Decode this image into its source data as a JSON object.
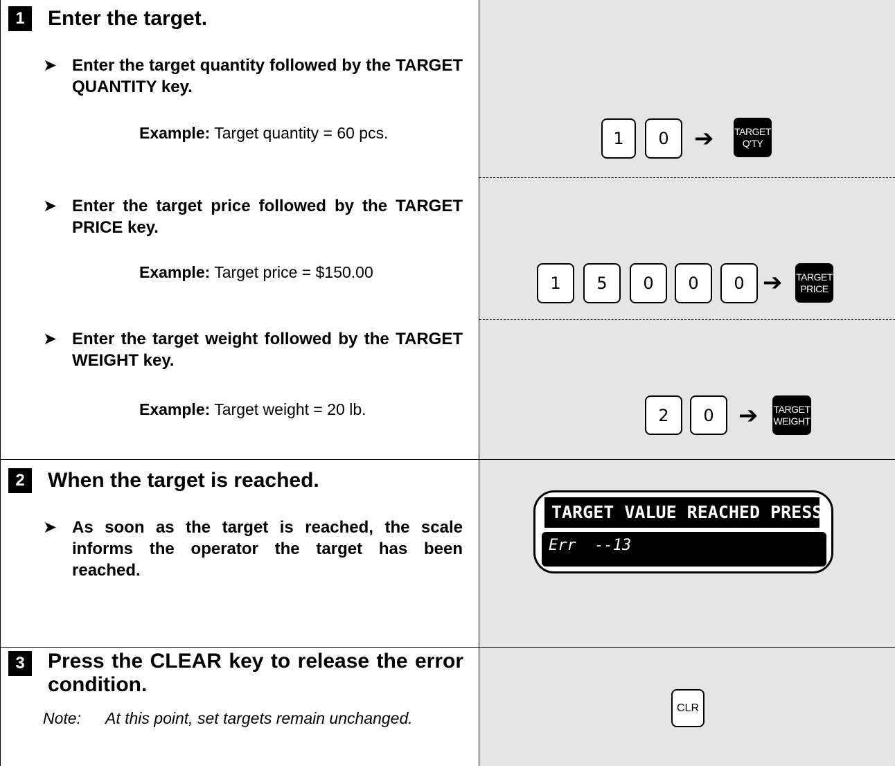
{
  "steps": [
    {
      "number": "1",
      "heading": "Enter the target.",
      "items": [
        {
          "instruction": "Enter the target quantity followed by the TARGET QUANTITY key.",
          "example_label": "Example:",
          "example_text": " Target quantity = 60 pcs.",
          "keys": [
            "1",
            "0"
          ],
          "function_key": [
            "TARGET",
            "Q'TY"
          ]
        },
        {
          "instruction": "Enter the target price followed by the TARGET PRICE key.",
          "example_label": "Example:",
          "example_text": " Target price = $150.00",
          "keys": [
            "1",
            "5",
            "0",
            "0",
            "0"
          ],
          "function_key": [
            "TARGET",
            "PRICE"
          ]
        },
        {
          "instruction": "Enter the target weight followed by the TARGET WEIGHT key.",
          "example_label": "Example:",
          "example_text": " Target weight = 20 lb.",
          "keys": [
            "2",
            "0"
          ],
          "function_key": [
            "TARGET",
            "WEIGHT"
          ]
        }
      ]
    },
    {
      "number": "2",
      "heading": "When the target is reached.",
      "instruction": "As soon as the target is reached, the scale informs the operator the target has been reached.",
      "display": {
        "top_line": "TARGET VALUE REACHED PRESS [OK]",
        "bottom_line": "Err  --13"
      }
    },
    {
      "number": "3",
      "heading": "Press the CLEAR key to release the error condition.",
      "note_label": "Note:",
      "note_text": "At this point, set targets remain unchanged.",
      "key": "CLR"
    }
  ],
  "bullet_symbol": "➤",
  "arrow_symbol": "➔"
}
